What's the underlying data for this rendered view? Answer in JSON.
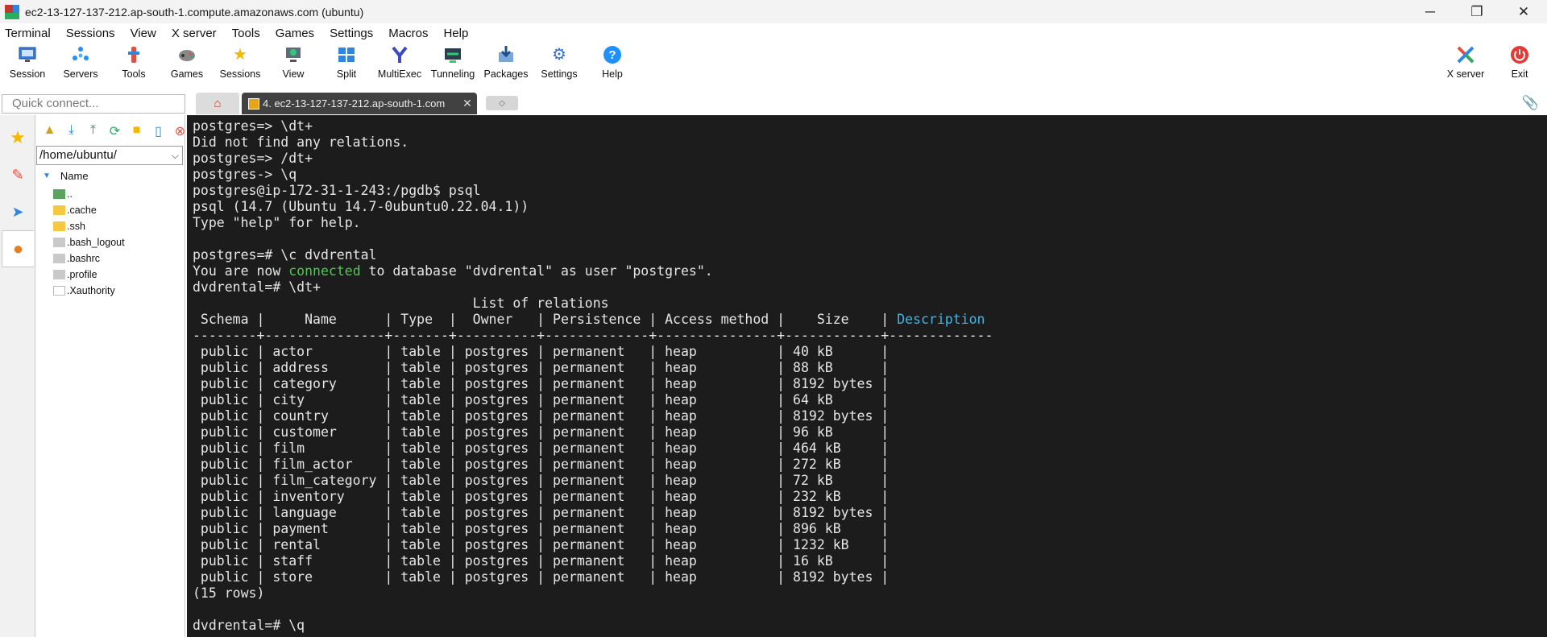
{
  "window": {
    "title": "ec2-13-127-137-212.ap-south-1.compute.amazonaws.com (ubuntu)",
    "controls": [
      "─",
      "❐",
      "✕"
    ]
  },
  "menu": [
    "Terminal",
    "Sessions",
    "View",
    "X server",
    "Tools",
    "Games",
    "Settings",
    "Macros",
    "Help"
  ],
  "toolbar": {
    "left": [
      {
        "label": "Session",
        "icon": "session-icon"
      },
      {
        "label": "Servers",
        "icon": "servers-icon"
      },
      {
        "label": "Tools",
        "icon": "tools-icon"
      },
      {
        "label": "Games",
        "icon": "games-icon"
      },
      {
        "label": "Sessions",
        "icon": "star-icon"
      },
      {
        "label": "View",
        "icon": "view-icon"
      },
      {
        "label": "Split",
        "icon": "split-icon"
      },
      {
        "label": "MultiExec",
        "icon": "multiexec-icon"
      },
      {
        "label": "Tunneling",
        "icon": "tunneling-icon"
      },
      {
        "label": "Packages",
        "icon": "packages-icon"
      },
      {
        "label": "Settings",
        "icon": "settings-icon"
      },
      {
        "label": "Help",
        "icon": "help-icon"
      }
    ],
    "right": [
      {
        "label": "X server",
        "icon": "xserver-icon"
      },
      {
        "label": "Exit",
        "icon": "exit-icon"
      }
    ]
  },
  "quick_connect": {
    "placeholder": "Quick connect..."
  },
  "tabs": {
    "session_tab": "4.  ec2-13-127-137-212.ap-south-1.com",
    "close": "✕"
  },
  "sftp": {
    "path": "/home/ubuntu/",
    "column_header": "Name",
    "files": [
      {
        "name": "..",
        "kind": "up"
      },
      {
        "name": ".cache",
        "kind": "folder"
      },
      {
        "name": ".ssh",
        "kind": "folder"
      },
      {
        "name": ".bash_logout",
        "kind": "doc"
      },
      {
        "name": ".bashrc",
        "kind": "doc"
      },
      {
        "name": ".profile",
        "kind": "doc"
      },
      {
        "name": ".Xauthority",
        "kind": "blank"
      }
    ]
  },
  "terminal": {
    "lines_before": [
      "postgres=> \\dt+",
      "Did not find any relations.",
      "postgres=> /dt+",
      "postgres-> \\q",
      "postgres@ip-172-31-1-243:/pgdb$ psql",
      "psql (14.7 (Ubuntu 14.7-0ubuntu0.22.04.1))",
      "Type \"help\" for help.",
      "",
      "postgres=# \\c dvdrental"
    ],
    "connected_line": {
      "before": "You are now ",
      "highlight": "connected",
      "after": " to database \"dvdrental\" as user \"postgres\"."
    },
    "command": "dvdrental=# \\dt+",
    "table_title": "                                   List of relations",
    "header": {
      "pre": " Schema |     Name      | Type  |  Owner   | Persistence | Access method |    Size    | ",
      "description": "Description"
    },
    "separator": "--------+---------------+-------+----------+-------------+---------------+------------+-------------",
    "rows": [
      " public | actor         | table | postgres | permanent   | heap          | 40 kB      |",
      " public | address       | table | postgres | permanent   | heap          | 88 kB      |",
      " public | category      | table | postgres | permanent   | heap          | 8192 bytes |",
      " public | city          | table | postgres | permanent   | heap          | 64 kB      |",
      " public | country       | table | postgres | permanent   | heap          | 8192 bytes |",
      " public | customer      | table | postgres | permanent   | heap          | 96 kB      |",
      " public | film          | table | postgres | permanent   | heap          | 464 kB     |",
      " public | film_actor    | table | postgres | permanent   | heap          | 272 kB     |",
      " public | film_category | table | postgres | permanent   | heap          | 72 kB      |",
      " public | inventory     | table | postgres | permanent   | heap          | 232 kB     |",
      " public | language      | table | postgres | permanent   | heap          | 8192 bytes |",
      " public | payment       | table | postgres | permanent   | heap          | 896 kB     |",
      " public | rental        | table | postgres | permanent   | heap          | 1232 kB    |",
      " public | staff         | table | postgres | permanent   | heap          | 16 kB      |",
      " public | store         | table | postgres | permanent   | heap          | 8192 bytes |"
    ],
    "row_count": "(15 rows)",
    "last_prompt": "dvdrental=# \\q"
  },
  "colors": {
    "terminal_bg": "#1c1c1c",
    "terminal_fg": "#e6e6e6",
    "connected": "#4ec94e",
    "description": "#3fb6e8"
  }
}
